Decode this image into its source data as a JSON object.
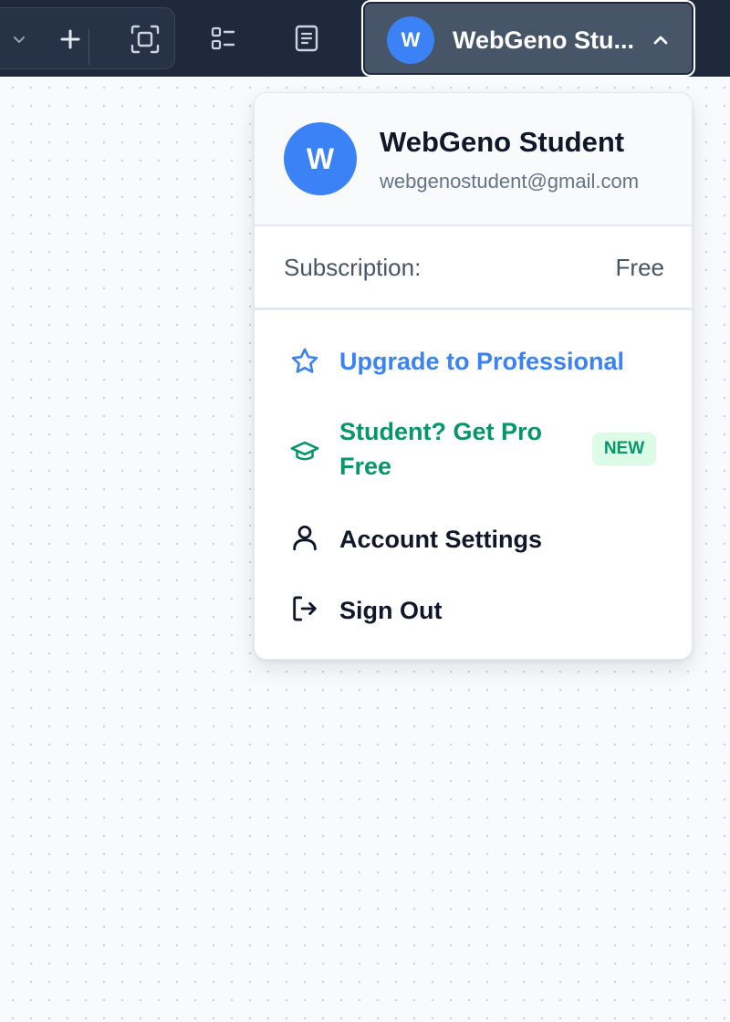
{
  "toolbar": {
    "icons": [
      "chevron-down-icon",
      "plus-icon",
      "fit-screen-icon",
      "list-icon",
      "document-icon"
    ]
  },
  "user_button": {
    "initial": "W",
    "name": "WebGeno Stu...",
    "chevron": "chevron-up-icon"
  },
  "menu": {
    "profile": {
      "initial": "W",
      "name": "WebGeno Student",
      "email": "webgenostudent@gmail.com"
    },
    "subscription": {
      "label": "Subscription:",
      "value": "Free"
    },
    "items": [
      {
        "label": "Upgrade to Professional",
        "icon": "star-icon",
        "color": "#3b82f6"
      },
      {
        "label_line1": "Student? Get Pro",
        "label_line2": "Free",
        "icon": "graduation-cap-icon",
        "color": "#059669",
        "badge": "NEW"
      },
      {
        "label": "Account Settings",
        "icon": "user-icon",
        "color": "#0f172a"
      },
      {
        "label": "Sign Out",
        "icon": "sign-out-icon",
        "color": "#0f172a"
      }
    ]
  },
  "colors": {
    "topbar": "#1e293b",
    "accent": "#3b82f6",
    "student_green": "#059669",
    "canvas": "#f8fafc"
  }
}
